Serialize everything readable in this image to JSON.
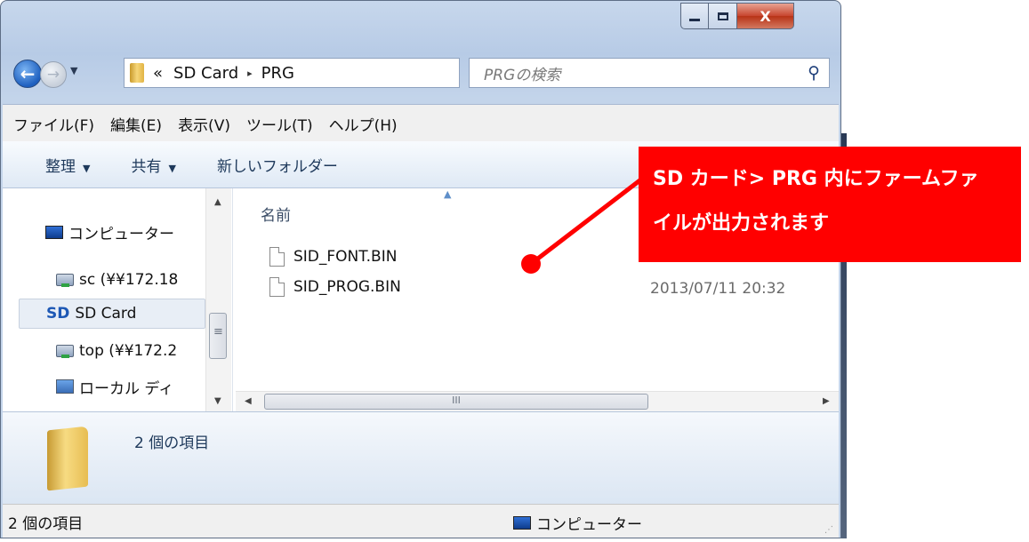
{
  "window": {
    "caption_buttons": {
      "close_glyph": "X"
    }
  },
  "address_bar": {
    "overflow": "«",
    "crumbs": [
      "SD Card",
      "PRG"
    ],
    "separator": "▸"
  },
  "search": {
    "placeholder": "PRGの検索"
  },
  "menu": [
    "ファイル(F)",
    "編集(E)",
    "表示(V)",
    "ツール(T)",
    "ヘルプ(H)"
  ],
  "toolbar": {
    "organize": "整理",
    "share": "共有",
    "new_folder": "新しいフォルダー"
  },
  "nav_pane": {
    "items": [
      {
        "label": "コンピューター",
        "icon": "computer-icon"
      },
      {
        "label": "sc (¥¥172.18",
        "icon": "network-drive-icon"
      },
      {
        "label": "SD Card",
        "icon": "sd-card-icon",
        "selected": true
      },
      {
        "label": "top (¥¥172.2",
        "icon": "network-drive-icon"
      },
      {
        "label": "ローカル ディ",
        "icon": "local-disk-icon"
      }
    ]
  },
  "file_list": {
    "column_name": "名前",
    "files": [
      {
        "name": "SID_FONT.BIN",
        "date": ""
      },
      {
        "name": "SID_PROG.BIN",
        "date": "2013/07/11 20:32"
      }
    ]
  },
  "details_pane": {
    "count_text": "2 個の項目"
  },
  "status_bar": {
    "count_text": "2 個の項目",
    "location": "コンピューター"
  },
  "callout": {
    "line1": "SD カード> PRG 内にファームファ",
    "line2": "イルが出力されます",
    "color": "#ff0000"
  }
}
